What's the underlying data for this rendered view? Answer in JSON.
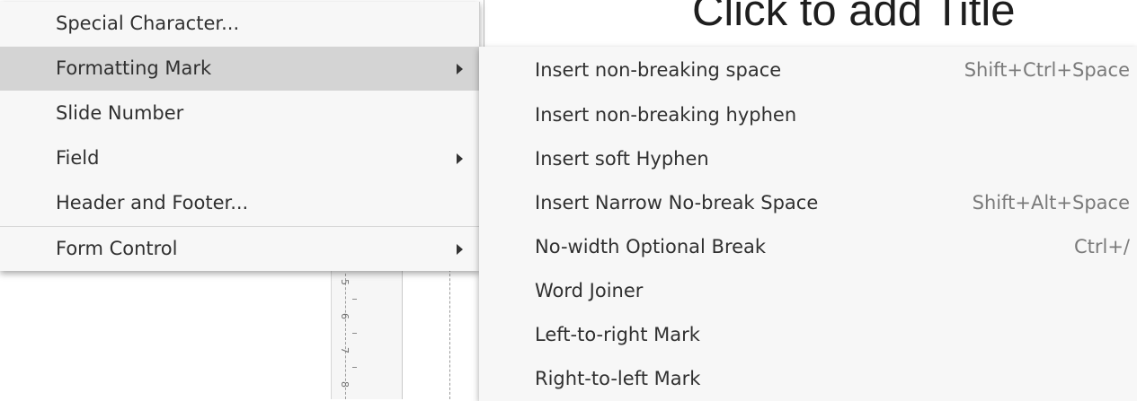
{
  "slide": {
    "title_fragment": "Click to add Title"
  },
  "ruler": {
    "numbers": [
      "5",
      "6",
      "7",
      "8"
    ]
  },
  "parent_menu": {
    "items": [
      {
        "label": "Special Character...",
        "submenu": false
      },
      {
        "label": "Formatting Mark",
        "submenu": true
      },
      {
        "label": "Slide Number",
        "submenu": false
      },
      {
        "label": "Field",
        "submenu": true
      },
      {
        "label": "Header and Footer...",
        "submenu": false
      },
      {
        "label": "Form Control",
        "submenu": true
      }
    ],
    "highlighted": "Formatting Mark"
  },
  "submenu": {
    "items": [
      {
        "label": "Insert non-breaking space",
        "shortcut": "Shift+Ctrl+Space"
      },
      {
        "label": "Insert non-breaking hyphen",
        "shortcut": ""
      },
      {
        "label": "Insert soft Hyphen",
        "shortcut": ""
      },
      {
        "label": "Insert Narrow No-break Space",
        "shortcut": "Shift+Alt+Space"
      },
      {
        "label": "No-width Optional Break",
        "shortcut": "Ctrl+/"
      },
      {
        "label": "Word Joiner",
        "shortcut": ""
      },
      {
        "label": "Left-to-right Mark",
        "shortcut": ""
      },
      {
        "label": "Right-to-left Mark",
        "shortcut": ""
      }
    ]
  },
  "colors": {
    "menu_bg": "#f7f7f7",
    "highlight": "#d4d4d4",
    "shortcut_text": "#7a7a7a"
  }
}
